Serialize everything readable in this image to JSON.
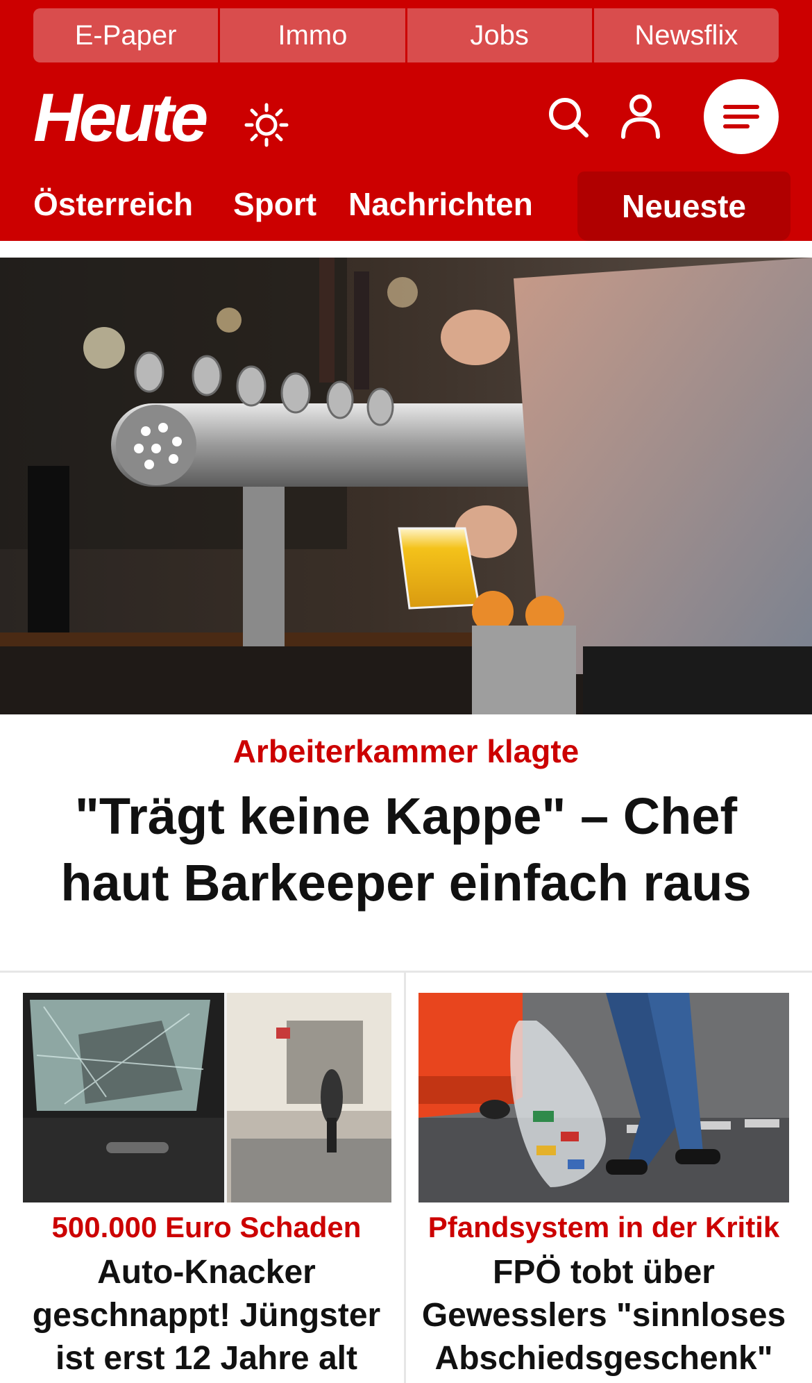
{
  "colors": {
    "brand_red": "#cc0000",
    "dark_red": "#b00000",
    "headline": "#111111"
  },
  "service_bar": [
    "E-Paper",
    "Immo",
    "Jobs",
    "Newsflix"
  ],
  "header": {
    "logo": "Heute",
    "icons": [
      "sun-icon",
      "search-icon",
      "user-icon",
      "menu-icon"
    ]
  },
  "nav": {
    "items": [
      "Österreich",
      "Sport",
      "Nachrichten"
    ],
    "active": "Neueste"
  },
  "hero": {
    "kicker": "Arbeiterkammer klagte",
    "headline": "\"Trägt keine Kappe\" – Chef haut Barkeeper einfach raus"
  },
  "cards": [
    {
      "kicker": "500.000 Euro Schaden",
      "title": "Auto-Knacker geschnappt! Jüngster ist erst 12 Jahre alt"
    },
    {
      "kicker": "Pfandsystem in der Kritik",
      "title": "FPÖ tobt über Gewesslers \"sinnloses Abschiedsgeschenk\""
    }
  ]
}
